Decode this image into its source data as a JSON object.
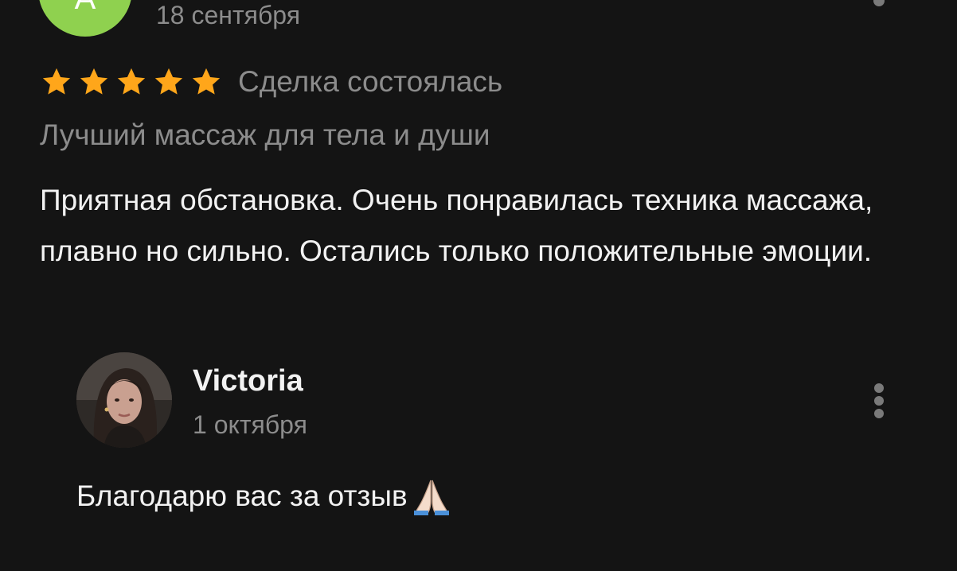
{
  "review": {
    "avatar_letter": "А",
    "avatar_color": "#8fd14f",
    "date": "18 сентября",
    "rating": 5,
    "rating_max": 5,
    "star_color": "#ffa61a",
    "deal_status": "Сделка состоялась",
    "service_name": "Лучший массаж для тела и души",
    "text": "Приятная обстановка.  Очень понравилась техника массажа, плавно но сильно.  Остались только положительные эмоции.",
    "menu_icon": "more-vertical-icon"
  },
  "reply": {
    "author_name": "Victoria",
    "date": "1 октября",
    "text": "Благодарю вас за отзыв",
    "emoji_icon": "folded-hands-icon",
    "menu_icon": "more-vertical-icon"
  },
  "theme": {
    "background": "#141414",
    "primary_text": "#f2f2f2",
    "secondary_text": "#8c8c8c"
  }
}
